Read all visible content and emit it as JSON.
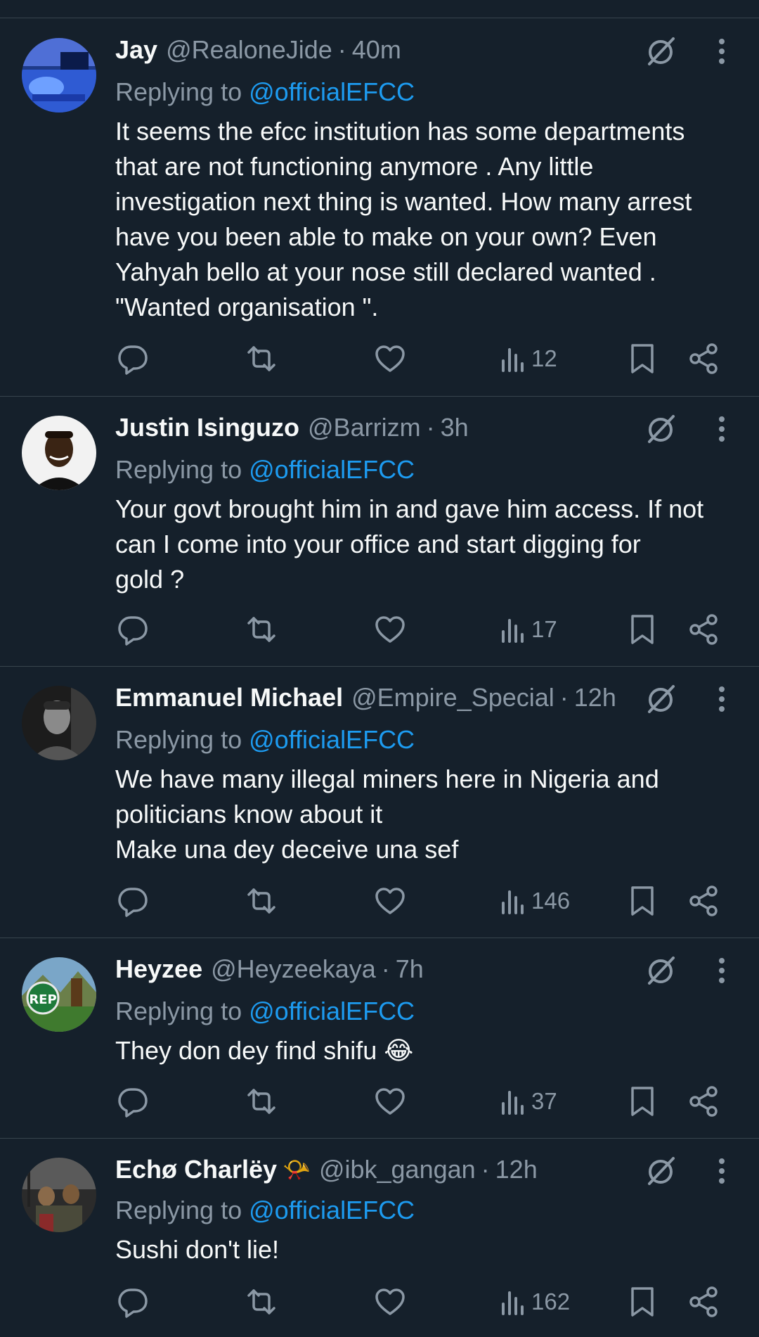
{
  "replying_label": "Replying to",
  "colors": {
    "background": "#15202b",
    "text": "#f7f9f9",
    "muted": "#8b98a5",
    "link": "#1d9bf0",
    "divider": "#38444d"
  },
  "tweets": [
    {
      "name": "Jay",
      "name_emoji": "",
      "handle": "@RealoneJide",
      "time": "40m",
      "reply_to": "@officialEFCC",
      "text": "It seems the efcc institution has some departments\nthat are not functioning anymore . Any little\ninvestigation next thing is wanted. How many arrest\nhave you been able to make on your own? Even\nYahyah bello at your nose still declared wanted .\n\"Wanted organisation \".",
      "views": "12",
      "avatar_icon": "avatar-room-blue"
    },
    {
      "name": "Justin Isinguzo",
      "name_emoji": "",
      "handle": "@Barrizm",
      "time": "3h",
      "reply_to": "@officialEFCC",
      "text": "Your govt brought him in and gave him access. If not\ncan I come into your office and start digging for\ngold ?",
      "views": "17",
      "avatar_icon": "avatar-portrait-light"
    },
    {
      "name": "Emmanuel Michael",
      "name_emoji": "",
      "handle": "@Empire_Special",
      "time": "12h",
      "reply_to": "@officialEFCC",
      "text": "We have many illegal miners here in Nigeria and\npoliticians know about it\nMake una dey deceive una sef",
      "views": "146",
      "avatar_icon": "avatar-portrait-dark"
    },
    {
      "name": "Heyzee",
      "name_emoji": "",
      "handle": "@Heyzeekaya",
      "time": "7h",
      "reply_to": "@officialEFCC",
      "text": "They don dey find shifu 😂",
      "views": "37",
      "avatar_icon": "avatar-rep-badge",
      "avatar_text": "REP"
    },
    {
      "name": "Echø Charlëy",
      "name_emoji": "📯",
      "handle": "@ibk_gangan",
      "time": "12h",
      "reply_to": "@officialEFCC",
      "text": "Sushi don't lie!",
      "views": "162",
      "avatar_icon": "avatar-group-photo"
    }
  ]
}
